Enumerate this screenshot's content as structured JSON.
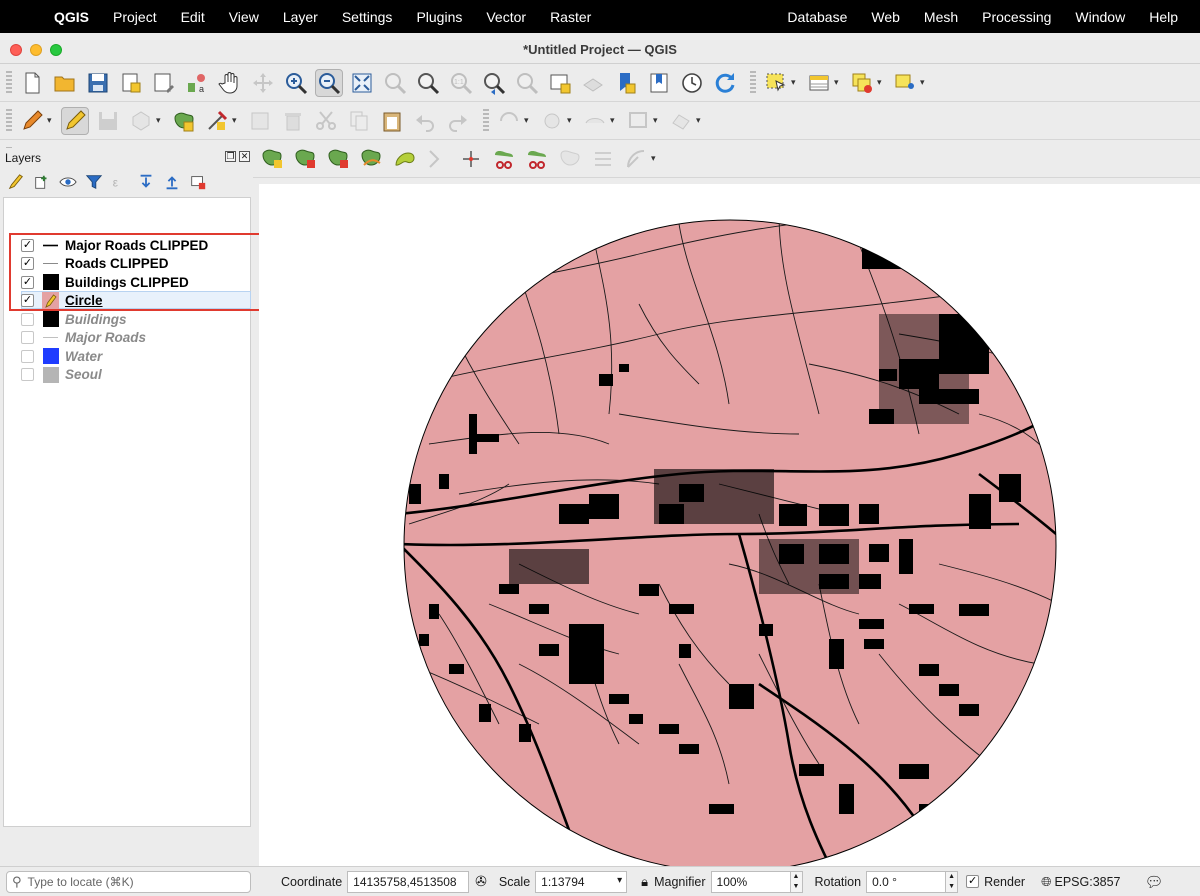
{
  "menubar": {
    "app_name": "QGIS",
    "items": [
      "Project",
      "Edit",
      "View",
      "Layer",
      "Settings",
      "Plugins",
      "Vector",
      "Raster"
    ],
    "right_items": [
      "Database",
      "Web",
      "Mesh",
      "Processing",
      "Window",
      "Help"
    ]
  },
  "window": {
    "title": "*Untitled Project — QGIS"
  },
  "layers_panel": {
    "title": "Layers",
    "layers": [
      {
        "name": "Major Roads CLIPPED",
        "checked": true,
        "symbol": "line",
        "color": "#000000"
      },
      {
        "name": "Roads CLIPPED",
        "checked": true,
        "symbol": "thin-line",
        "color": "#8a8a8a"
      },
      {
        "name": "Buildings CLIPPED",
        "checked": true,
        "symbol": "fill",
        "color": "#000000"
      },
      {
        "name": "Circle",
        "checked": true,
        "symbol": "edit-fill",
        "color": "#e4a1a3"
      },
      {
        "name": "Buildings",
        "checked": false,
        "symbol": "fill",
        "color": "#000000"
      },
      {
        "name": "Major Roads",
        "checked": false,
        "symbol": "thin-line",
        "color": "#c0c0c0"
      },
      {
        "name": "Water",
        "checked": false,
        "symbol": "fill",
        "color": "#1f3cff"
      },
      {
        "name": "Seoul",
        "checked": false,
        "symbol": "fill",
        "color": "#b5b5b5"
      }
    ]
  },
  "map": {
    "fill_color": "#e4a1a3",
    "stroke_color": "#000000"
  },
  "statusbar": {
    "locate_placeholder": "Type to locate (⌘K)",
    "coordinate_label": "Coordinate",
    "coordinate_value": "14135758,4513508",
    "scale_label": "Scale",
    "scale_value": "1:13794",
    "magnifier_label": "Magnifier",
    "magnifier_value": "100%",
    "rotation_label": "Rotation",
    "rotation_value": "0.0 °",
    "render_label": "Render",
    "crs_label": "EPSG:3857"
  }
}
